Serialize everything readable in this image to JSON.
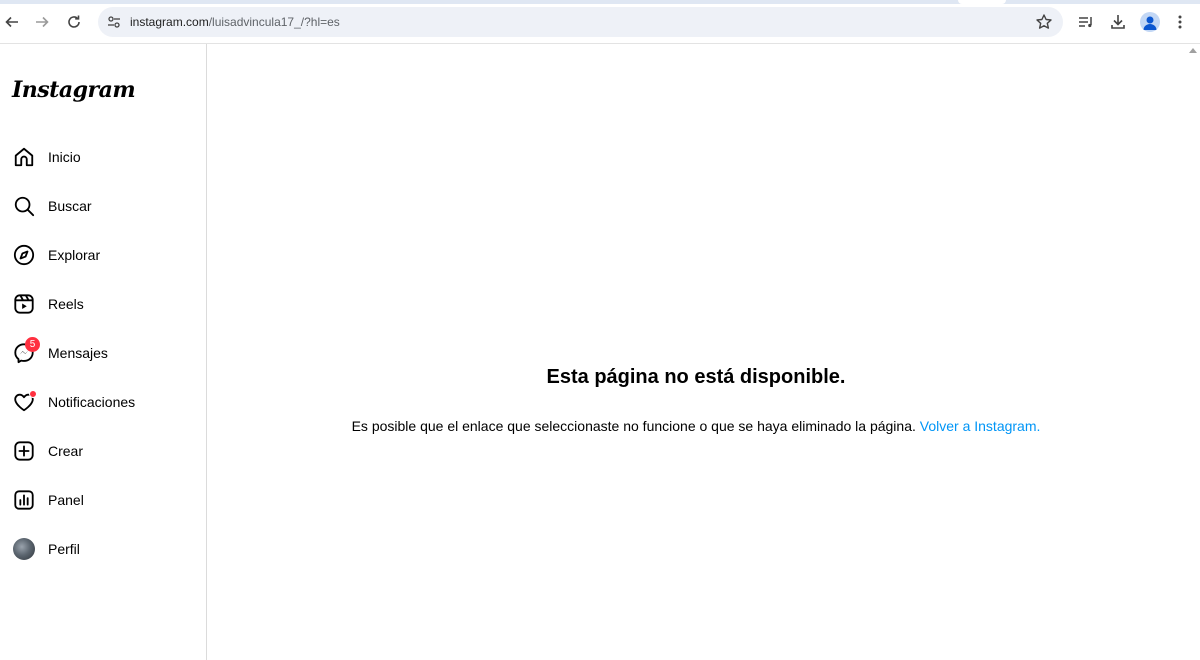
{
  "browser": {
    "url_host": "instagram.com",
    "url_rest": "/luisadvincula17_/?hl=es",
    "colors": {
      "omnibox_bg": "#eef1f7",
      "accent": "#0b57d0"
    }
  },
  "sidebar": {
    "logo": "Instagram",
    "items": [
      {
        "label": "Inicio",
        "icon": "home-icon"
      },
      {
        "label": "Buscar",
        "icon": "search-icon"
      },
      {
        "label": "Explorar",
        "icon": "compass-icon"
      },
      {
        "label": "Reels",
        "icon": "reels-icon"
      },
      {
        "label": "Mensajes",
        "icon": "messenger-icon",
        "badge": "5"
      },
      {
        "label": "Notificaciones",
        "icon": "heart-icon",
        "dot": true
      },
      {
        "label": "Crear",
        "icon": "plus-square-icon"
      },
      {
        "label": "Panel",
        "icon": "chart-icon"
      },
      {
        "label": "Perfil",
        "icon": "profile-avatar"
      }
    ]
  },
  "main": {
    "title": "Esta página no está disponible.",
    "message": "Es posible que el enlace que seleccionaste no funcione o que se haya eliminado la página.",
    "link": "Volver a Instagram.",
    "colors": {
      "link": "#0095f6",
      "badge": "#ff3040"
    }
  }
}
